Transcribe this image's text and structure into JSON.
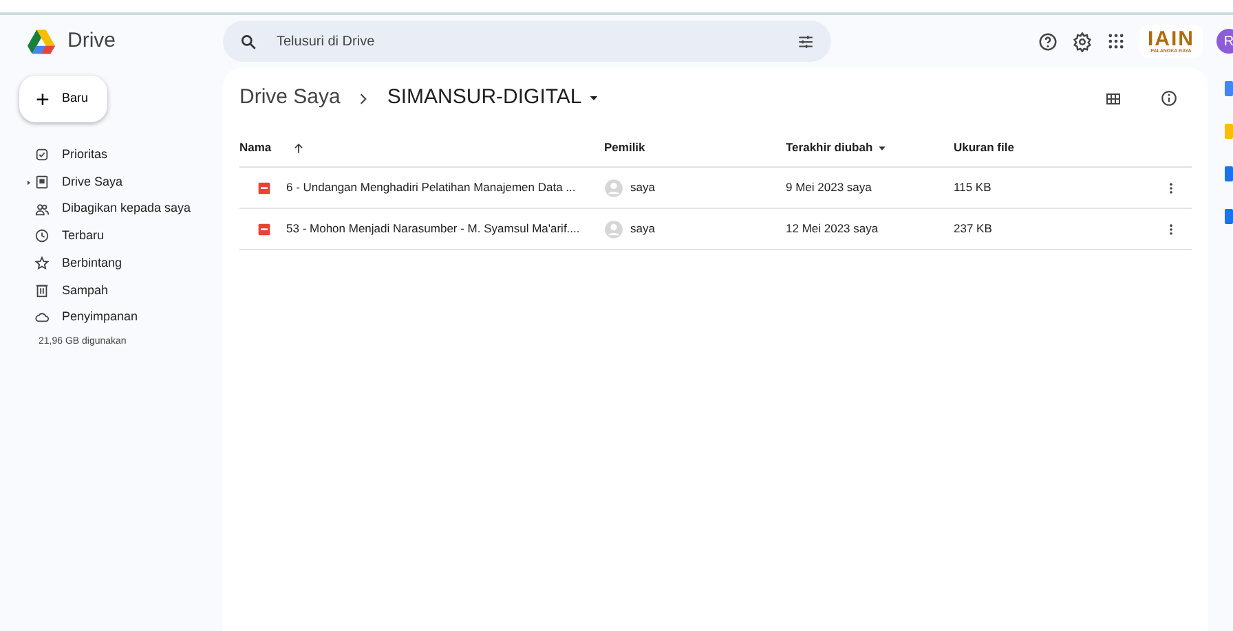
{
  "app": {
    "name": "Drive"
  },
  "search": {
    "placeholder": "Telusuri di Drive"
  },
  "header": {
    "logo_text": "IAIN",
    "logo_subtext": "PALANGKA RAYA",
    "avatar": "R"
  },
  "new_button": {
    "label": "Baru",
    "symbol": "+"
  },
  "sidebar": {
    "items": [
      {
        "label": "Prioritas",
        "expandable": false
      },
      {
        "label": "Drive Saya",
        "expandable": true
      },
      {
        "label": "Dibagikan kepada saya",
        "expandable": false
      },
      {
        "label": "Terbaru",
        "expandable": false
      },
      {
        "label": "Berbintang",
        "expandable": false
      },
      {
        "label": "Sampah",
        "expandable": false
      },
      {
        "label": "Penyimpanan",
        "expandable": false
      }
    ],
    "storage": "21,96 GB digunakan"
  },
  "breadcrumb": [
    "Drive Saya",
    "SIMANSUR-DIGITAL"
  ],
  "table": {
    "columns": [
      {
        "label": "Nama",
        "kind": "ascending"
      },
      {
        "label": "Pemilik",
        "kind": "plain"
      },
      {
        "label": "Terakhir diubah",
        "kind": "menu"
      },
      {
        "label": "Ukuran file",
        "kind": "plain"
      }
    ],
    "rows": [
      {
        "name": "6 - Undangan Menghadiri Pelatihan Manajemen Data ...",
        "owner": "saya",
        "modified": "9 Mei 2023 saya",
        "size": "115 KB"
      },
      {
        "name": "53 - Mohon Menjadi Narasumber - M. Syamsul Ma'arif....",
        "owner": "saya",
        "modified": "12 Mei 2023 saya",
        "size": "237 KB"
      }
    ]
  }
}
